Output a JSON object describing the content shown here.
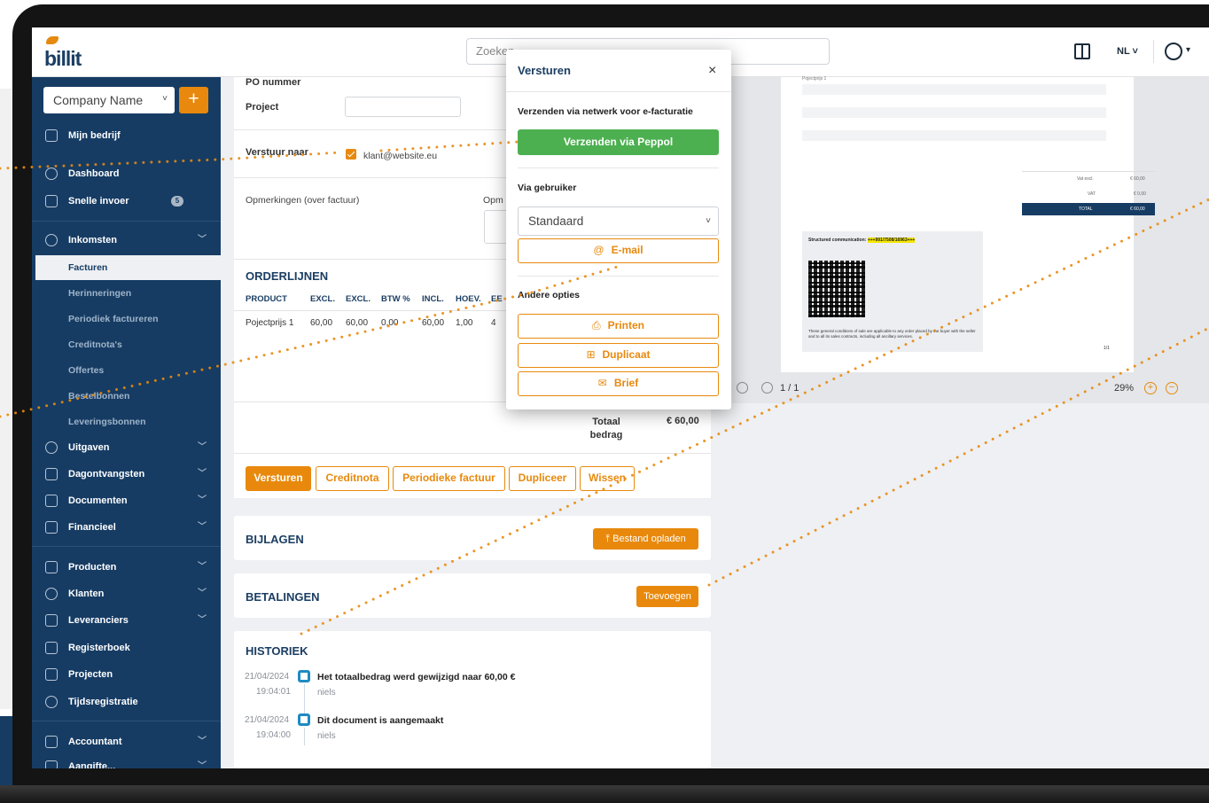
{
  "app": {
    "logo_text": "billit",
    "search_placeholder": "Zoeken",
    "lang": "NL"
  },
  "sidebar": {
    "company": "Company Name",
    "items": [
      {
        "label": "Mijn bedrijf"
      },
      {
        "label": "Dashboard"
      },
      {
        "label": "Snelle invoer",
        "badge": "5"
      },
      {
        "label": "Inkomsten"
      },
      {
        "label": "Facturen"
      },
      {
        "label": "Herinneringen"
      },
      {
        "label": "Periodiek factureren"
      },
      {
        "label": "Creditnota's"
      },
      {
        "label": "Offertes"
      },
      {
        "label": "Bestelbonnen"
      },
      {
        "label": "Leveringsbonnen"
      },
      {
        "label": "Uitgaven"
      },
      {
        "label": "Dagontvangsten"
      },
      {
        "label": "Documenten"
      },
      {
        "label": "Financieel"
      },
      {
        "label": "Producten"
      },
      {
        "label": "Klanten"
      },
      {
        "label": "Leveranciers"
      },
      {
        "label": "Registerboek"
      },
      {
        "label": "Projecten"
      },
      {
        "label": "Tijdsregistratie"
      },
      {
        "label": "Accountant"
      },
      {
        "label": "Aangifte..."
      }
    ]
  },
  "form": {
    "po_label": "PO nummer",
    "project_label": "Project",
    "send_to_label": "Verstuur naar",
    "send_to_email": "klant@website.eu",
    "remarks_label": "Opmerkingen (over factuur)",
    "remarks2_label": "Opm"
  },
  "orderlines": {
    "title": "ORDERLIJNEN",
    "headers": [
      "PRODUCT",
      "EXCL.",
      "EXCL.",
      "BTW %",
      "INCL.",
      "HOEV.",
      "EE"
    ],
    "row": [
      "Pojectprijs 1",
      "60,00",
      "60,00",
      "0,00",
      "60,00",
      "1,00",
      "4"
    ]
  },
  "totals": {
    "label": "Totaal bedrag",
    "value": "€ 60,00"
  },
  "actions": [
    "Versturen",
    "Creditnota",
    "Periodieke factuur",
    "Dupliceer",
    "Wissen"
  ],
  "bijlagen": {
    "title": "BIJLAGEN",
    "button": "Bestand opladen"
  },
  "betalingen": {
    "title": "BETALINGEN",
    "button": "Toevoegen"
  },
  "historiek": {
    "title": "HISTORIEK",
    "entries": [
      {
        "date": "21/04/2024",
        "time": "19:04:01",
        "text": "Het totaalbedrag werd gewijzigd naar 60,00 €",
        "user": "niels"
      },
      {
        "date": "21/04/2024",
        "time": "19:04:00",
        "text": "Dit document is aangemaakt",
        "user": "niels"
      }
    ]
  },
  "preview": {
    "row_label": "Pojectprijs 1",
    "totals": [
      {
        "label": "Vat excl.",
        "value": "€ 60,00"
      },
      {
        "label": "VAT",
        "value": "€ 0,00"
      }
    ],
    "total": {
      "label": "TOTAL",
      "value": "€ 60,00"
    },
    "structured_label": "Structured communication:",
    "structured_value": "+++991/7508/16963+++",
    "legal": "These general conditions of sale are applicable to any order placed by the buyer with the seller and to all its sales contracts, including all ancillary services.",
    "page": "1/1",
    "pager": "1 / 1",
    "zoom": "29%"
  },
  "modal": {
    "title": "Versturen",
    "close": "×",
    "section1": "Verzenden via netwerk voor e-facturatie",
    "peppol_button": "Verzenden via Peppol",
    "section2": "Via gebruiker",
    "select_value": "Standaard",
    "email_button": "E-mail",
    "section3": "Andere opties",
    "print_button": "Printen",
    "duplicate_button": "Duplicaat",
    "letter_button": "Brief"
  },
  "colors": {
    "navy": "#163c64",
    "orange": "#e8890d",
    "green": "#4cb050"
  }
}
